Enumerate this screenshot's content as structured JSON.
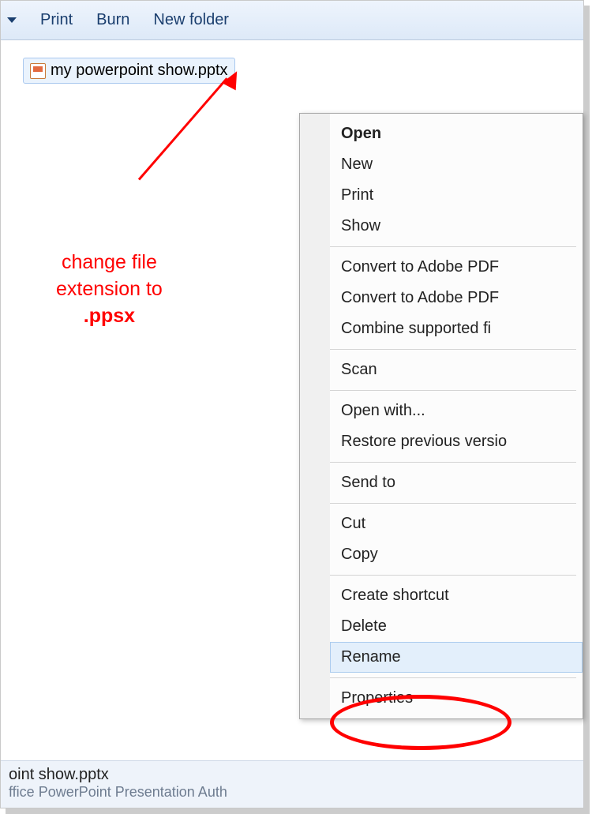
{
  "toolbar": {
    "items": [
      "Print",
      "Burn",
      "New folder"
    ]
  },
  "file": {
    "name": "my powerpoint show.pptx"
  },
  "annotation": {
    "line1": "change file",
    "line2": "extension to",
    "line3": ".ppsx"
  },
  "context_menu": {
    "groups": [
      [
        {
          "label": "Open",
          "bold": true
        },
        {
          "label": "New"
        },
        {
          "label": "Print"
        },
        {
          "label": "Show"
        }
      ],
      [
        {
          "label": "Convert to Adobe PDF",
          "icon": "pdf"
        },
        {
          "label": "Convert to Adobe PDF",
          "icon": "pdf2"
        },
        {
          "label": "Combine supported fi",
          "icon": "combine"
        }
      ],
      [
        {
          "label": "Scan",
          "icon": "shield"
        }
      ],
      [
        {
          "label": "Open with..."
        },
        {
          "label": "Restore previous versio"
        }
      ],
      [
        {
          "label": "Send to"
        }
      ],
      [
        {
          "label": "Cut"
        },
        {
          "label": "Copy"
        }
      ],
      [
        {
          "label": "Create shortcut"
        },
        {
          "label": "Delete"
        },
        {
          "label": "Rename",
          "hover": true
        }
      ],
      [
        {
          "label": "Properties"
        }
      ]
    ]
  },
  "status": {
    "line1": "oint show.pptx",
    "line2": "ffice PowerPoint Presentation   Auth"
  }
}
